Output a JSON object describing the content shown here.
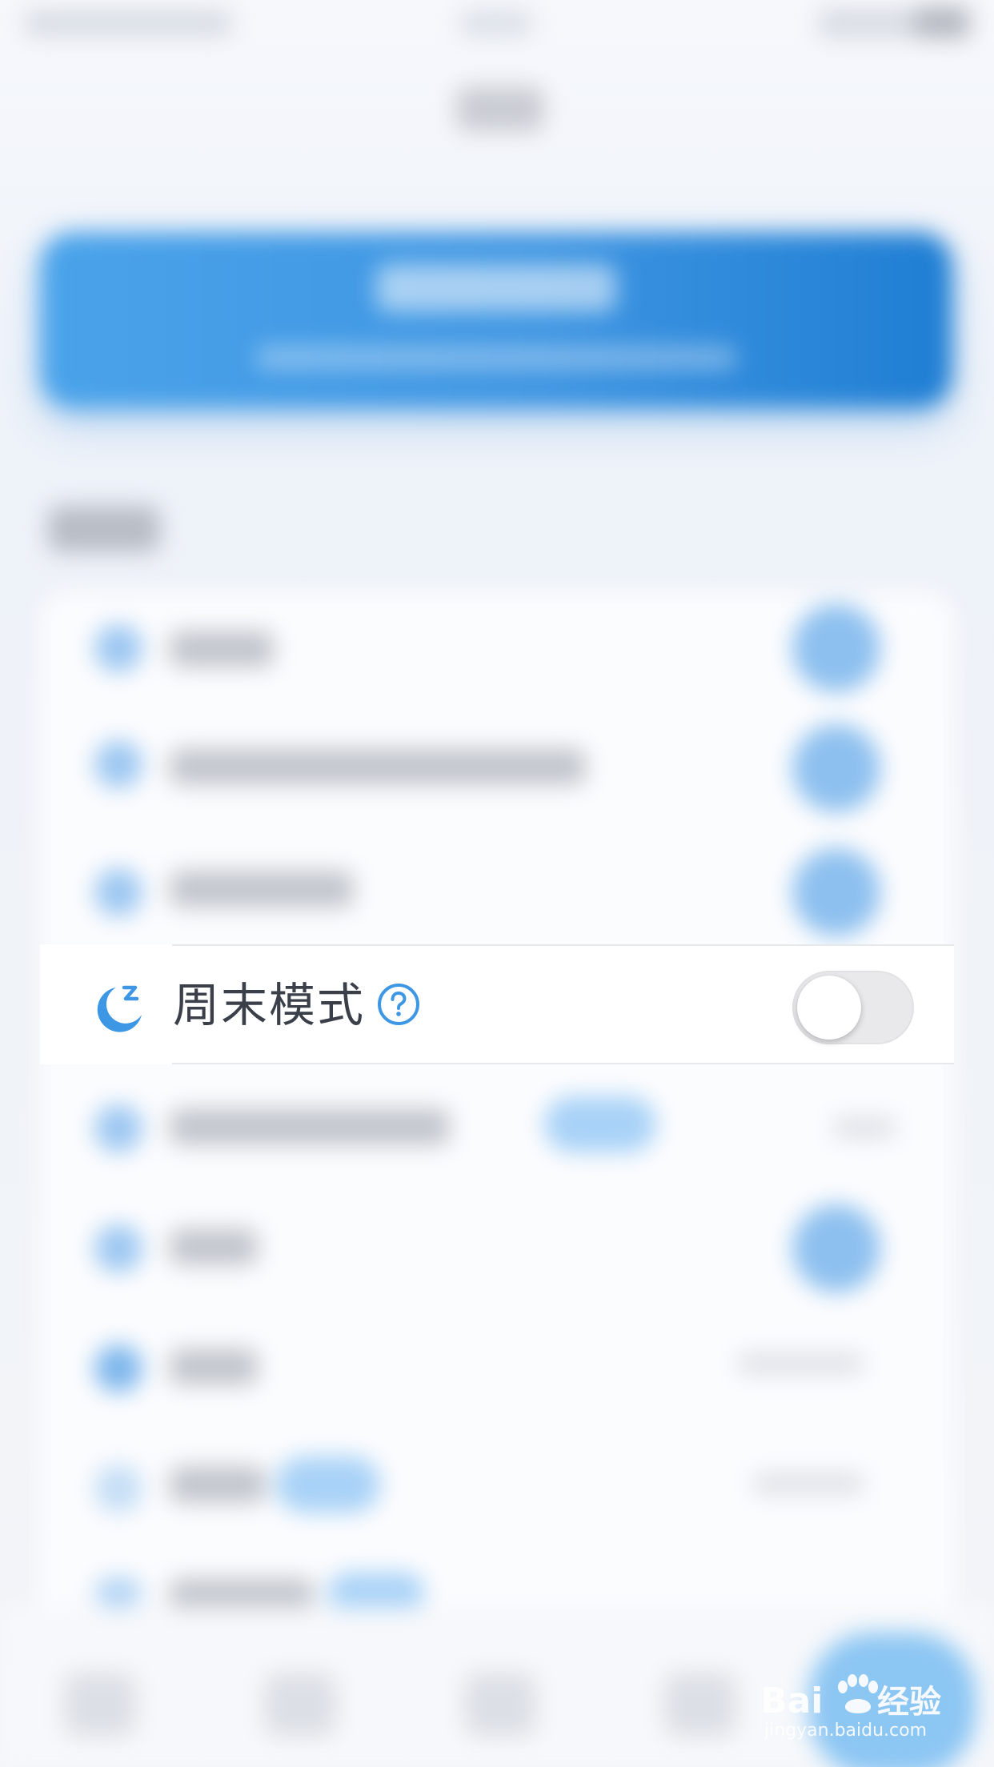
{
  "focused_setting": {
    "label": "周末模式",
    "icon": "moon-sleep-icon",
    "help_icon": "question-circle-icon",
    "toggle_on": false
  },
  "watermark": {
    "brand": "Baidu经验",
    "url": "jingyan.baidu.com"
  },
  "colors": {
    "accent": "#3d97e4",
    "toggle_off": "#e9e9eb",
    "label": "#3a3f4a"
  }
}
